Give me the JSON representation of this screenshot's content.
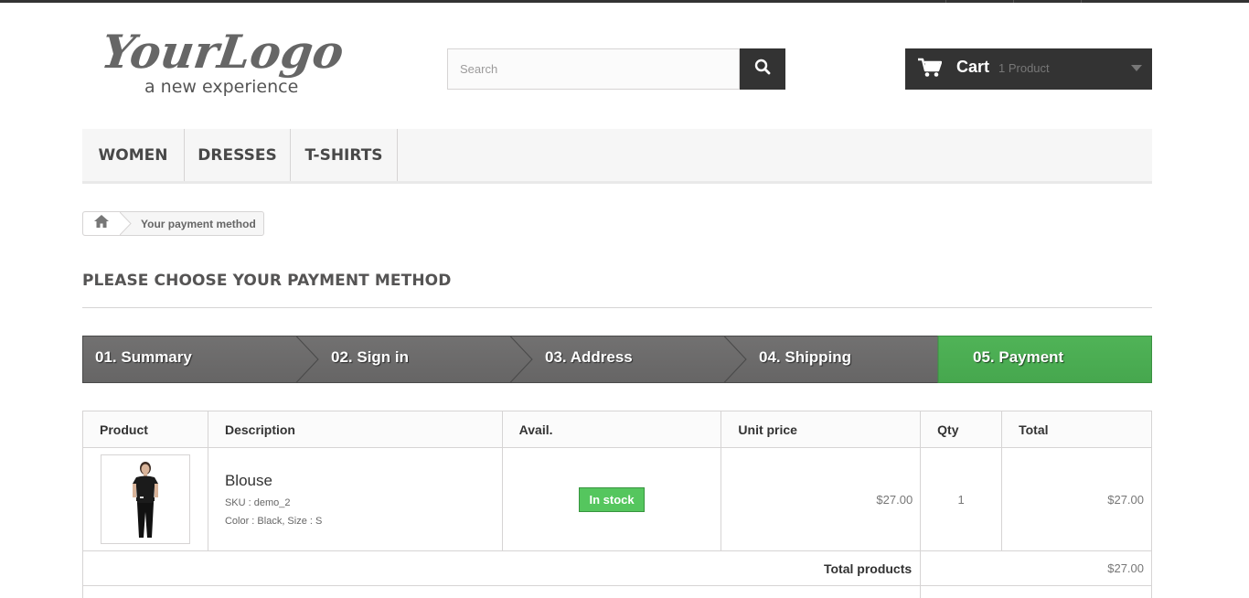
{
  "header": {
    "logo": {
      "main_text": "YourLogo",
      "tagline": "a new experience"
    },
    "search": {
      "placeholder": "Search"
    },
    "cart": {
      "label": "Cart",
      "qty_text": "1 Product"
    }
  },
  "menu": {
    "items": [
      "WOMEN",
      "DRESSES",
      "T-SHIRTS"
    ]
  },
  "breadcrumb": {
    "current": "Your payment method"
  },
  "page": {
    "title": "PLEASE CHOOSE YOUR PAYMENT METHOD"
  },
  "steps": [
    {
      "label": "01. Summary"
    },
    {
      "label": "02. Sign in"
    },
    {
      "label": "03. Address"
    },
    {
      "label": "04. Shipping"
    },
    {
      "label": "05. Payment"
    }
  ],
  "table": {
    "headers": [
      "Product",
      "Description",
      "Avail.",
      "Unit price",
      "Qty",
      "Total"
    ],
    "rows": [
      {
        "name": "Blouse",
        "sku": "SKU : demo_2",
        "attributes": "Color : Black, Size : S",
        "availability": "In stock",
        "unit_price": "$27.00",
        "qty": "1",
        "total": "$27.00"
      }
    ],
    "total_products_label": "Total products",
    "total_products_value": "$27.00"
  },
  "colors": {
    "dark": "#333333",
    "step_inactive": "#666666",
    "step_active": "#46a74e",
    "in_stock": "#55c65e"
  }
}
